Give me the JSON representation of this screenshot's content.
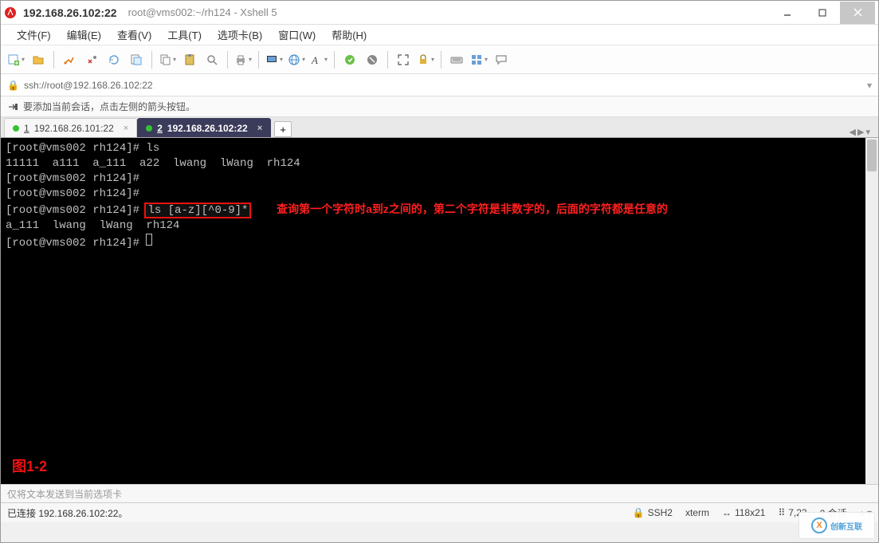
{
  "window": {
    "ip_title": "192.168.26.102:22",
    "full_title": "root@vms002:~/rh124 - Xshell 5"
  },
  "menu": {
    "file": "文件(F)",
    "edit": "编辑(E)",
    "view": "查看(V)",
    "tools": "工具(T)",
    "tabs": "选项卡(B)",
    "window": "窗口(W)",
    "help": "帮助(H)"
  },
  "toolbar_icons": [
    "new-session-icon",
    "open-icon",
    "connect-icon",
    "disconnect-icon",
    "properties-icon",
    "copy-icon",
    "paste-icon",
    "find-icon",
    "print-icon",
    "transfer-icon",
    "web-icon",
    "font-icon",
    "color-icon",
    "refresh-icon",
    "fullscreen-icon",
    "lock-icon",
    "keyboard-icon",
    "tile-icon",
    "chat-icon"
  ],
  "address": {
    "scheme_icon": "lock-icon",
    "url": "ssh://root@192.168.26.102:22",
    "dropdown": "▾"
  },
  "hint": {
    "icon": "arrow-add-icon",
    "text": "要添加当前会话，点击左侧的箭头按钮。"
  },
  "tabs": {
    "items": [
      {
        "num": "1",
        "label": "192.168.26.101:22",
        "active": false
      },
      {
        "num": "2",
        "label": "192.168.26.102:22",
        "active": true
      }
    ],
    "add": "+"
  },
  "terminal": {
    "lines": [
      "[root@vms002 rh124]# ls",
      "11111  a111  a_111  a22  lwang  lWang  rh124",
      "[root@vms002 rh124]#",
      "[root@vms002 rh124]#",
      "[root@vms002 rh124]# ",
      "a_111  lwang  lWang  rh124",
      "[root@vms002 rh124]# "
    ],
    "highlight_cmd": "ls [a-z][^0-9]*",
    "annotation": "查询第一个字符时a到z之间的，第二个字符是非数字的，后面的字符都是任意的",
    "fig_label": "图1-2"
  },
  "inputbar": {
    "placeholder": "仅将文本发送到当前选项卡"
  },
  "statusbar": {
    "left": "已连接 192.168.26.102:22。",
    "ssh": "SSH2",
    "term": "xterm",
    "size": "118x21",
    "pos": "7,22",
    "sessions": "2 会话"
  },
  "watermark": {
    "text": "创新互联"
  }
}
